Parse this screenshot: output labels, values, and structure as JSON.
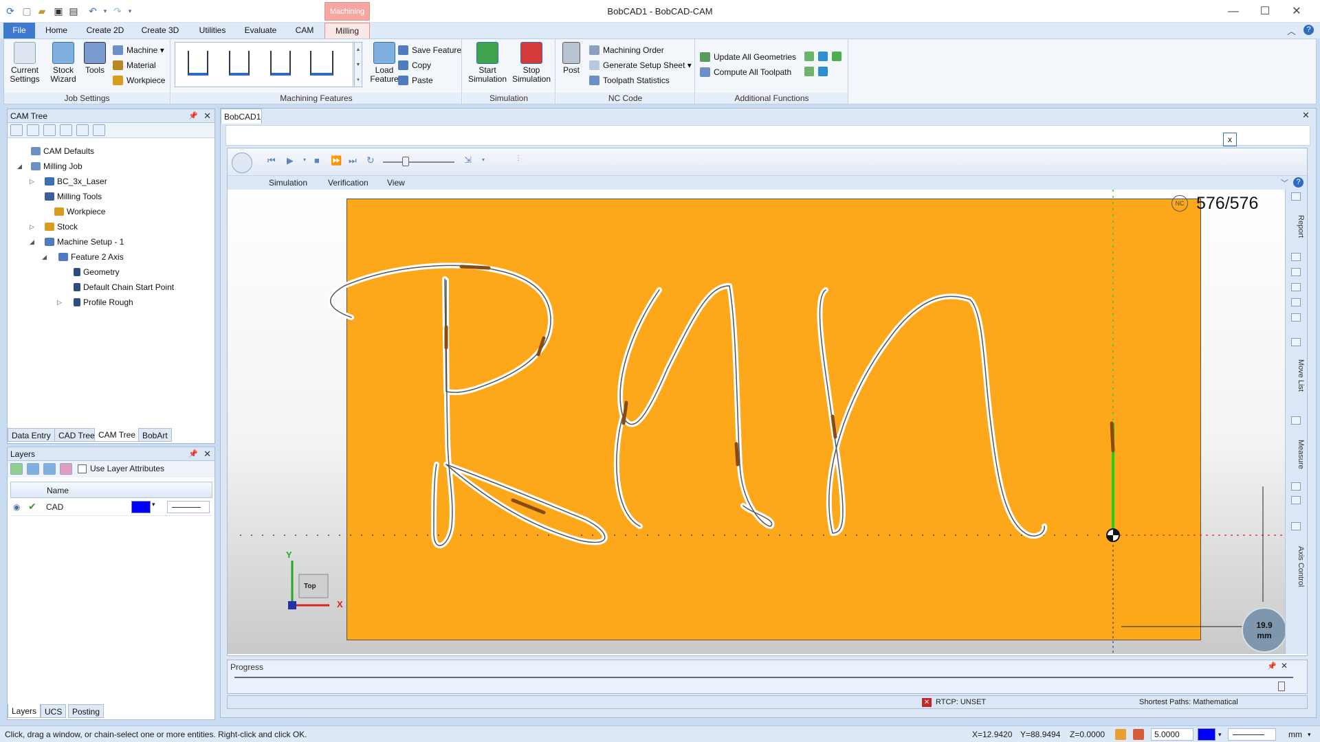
{
  "window": {
    "title": "BobCAD1 - BobCAD-CAM",
    "contextual_tab_group": "Machining",
    "controls": {
      "minimize": "—",
      "maximize": "☐",
      "close": "✕"
    }
  },
  "ribbon_tabs": [
    "File",
    "Home",
    "Create 2D",
    "Create 3D",
    "Utilities",
    "Evaluate",
    "CAM",
    "Milling"
  ],
  "ribbon": {
    "job_settings": {
      "label": "Job Settings",
      "current_settings": "Current Settings",
      "stock_wizard": "Stock Wizard",
      "tools": "Tools",
      "machine": "Machine",
      "material": "Material",
      "workpiece": "Workpiece"
    },
    "machining_features": {
      "label": "Machining Features",
      "load_feature": "Load Feature",
      "save_feature": "Save Feature",
      "copy": "Copy",
      "paste": "Paste"
    },
    "simulation": {
      "label": "Simulation",
      "start": "Start Simulation",
      "stop": "Stop Simulation"
    },
    "nc_code": {
      "label": "NC Code",
      "post": "Post",
      "machining_order": "Machining Order",
      "setup_sheet": "Generate Setup Sheet",
      "toolpath_stats": "Toolpath Statistics"
    },
    "additional": {
      "label": "Additional Functions",
      "update_geometries": "Update All Geometries",
      "compute_toolpath": "Compute All Toolpath"
    }
  },
  "cam_tree": {
    "title": "CAM Tree",
    "items": [
      {
        "label": "CAM Defaults",
        "color": "#6b8fc7"
      },
      {
        "label": "Milling Job",
        "color": "#6b8fc7"
      },
      {
        "label": "BC_3x_Laser",
        "color": "#3a6fb0"
      },
      {
        "label": "Milling Tools",
        "color": "#3a5f99"
      },
      {
        "label": "Workpiece",
        "color": "#d89c1f"
      },
      {
        "label": "Stock",
        "color": "#d89c1f"
      },
      {
        "label": "Machine Setup - 1",
        "color": "#4f7cc0"
      },
      {
        "label": "Feature 2 Axis",
        "color": "#4f7cc0"
      },
      {
        "label": "Geometry",
        "color": "#2d4d80"
      },
      {
        "label": "Default Chain Start Point",
        "color": "#2d4d80"
      },
      {
        "label": "Profile Rough",
        "color": "#2d4d80"
      }
    ],
    "bottom_tabs": [
      "Data Entry",
      "CAD Tree",
      "CAM Tree",
      "BobArt"
    ]
  },
  "layers": {
    "title": "Layers",
    "use_layer_attributes": "Use Layer Attributes",
    "col_name": "Name",
    "rows": [
      {
        "name": "CAD",
        "color": "#0000ff"
      }
    ],
    "bottom_tabs": [
      "Layers",
      "UCS",
      "Posting"
    ]
  },
  "document": {
    "tab": "BobCAD1",
    "close": "x",
    "sub_tabs": [
      "Simulation",
      "Verification",
      "View"
    ],
    "nc_counter": "576/576",
    "nc_badge": "NC",
    "scale_value": "19.9",
    "scale_unit": "mm",
    "axis_x": "X",
    "axis_y": "Y",
    "view_cube": "Top",
    "side_tabs": [
      "Report",
      "Move List",
      "Measure",
      "Axis Control"
    ],
    "progress_label": "Progress",
    "rtcp": "RTCP: UNSET",
    "shortest_paths": "Shortest Paths: Mathematical",
    "stock_color": "#fda81b"
  },
  "status": {
    "prompt": "Click, drag a window, or chain-select one or more entities. Right-click and click OK.",
    "x": "X=12.9420",
    "y": "Y=88.9494",
    "z": "Z=0.0000",
    "value": "5.0000",
    "units": "mm",
    "color": "#0000ff"
  }
}
